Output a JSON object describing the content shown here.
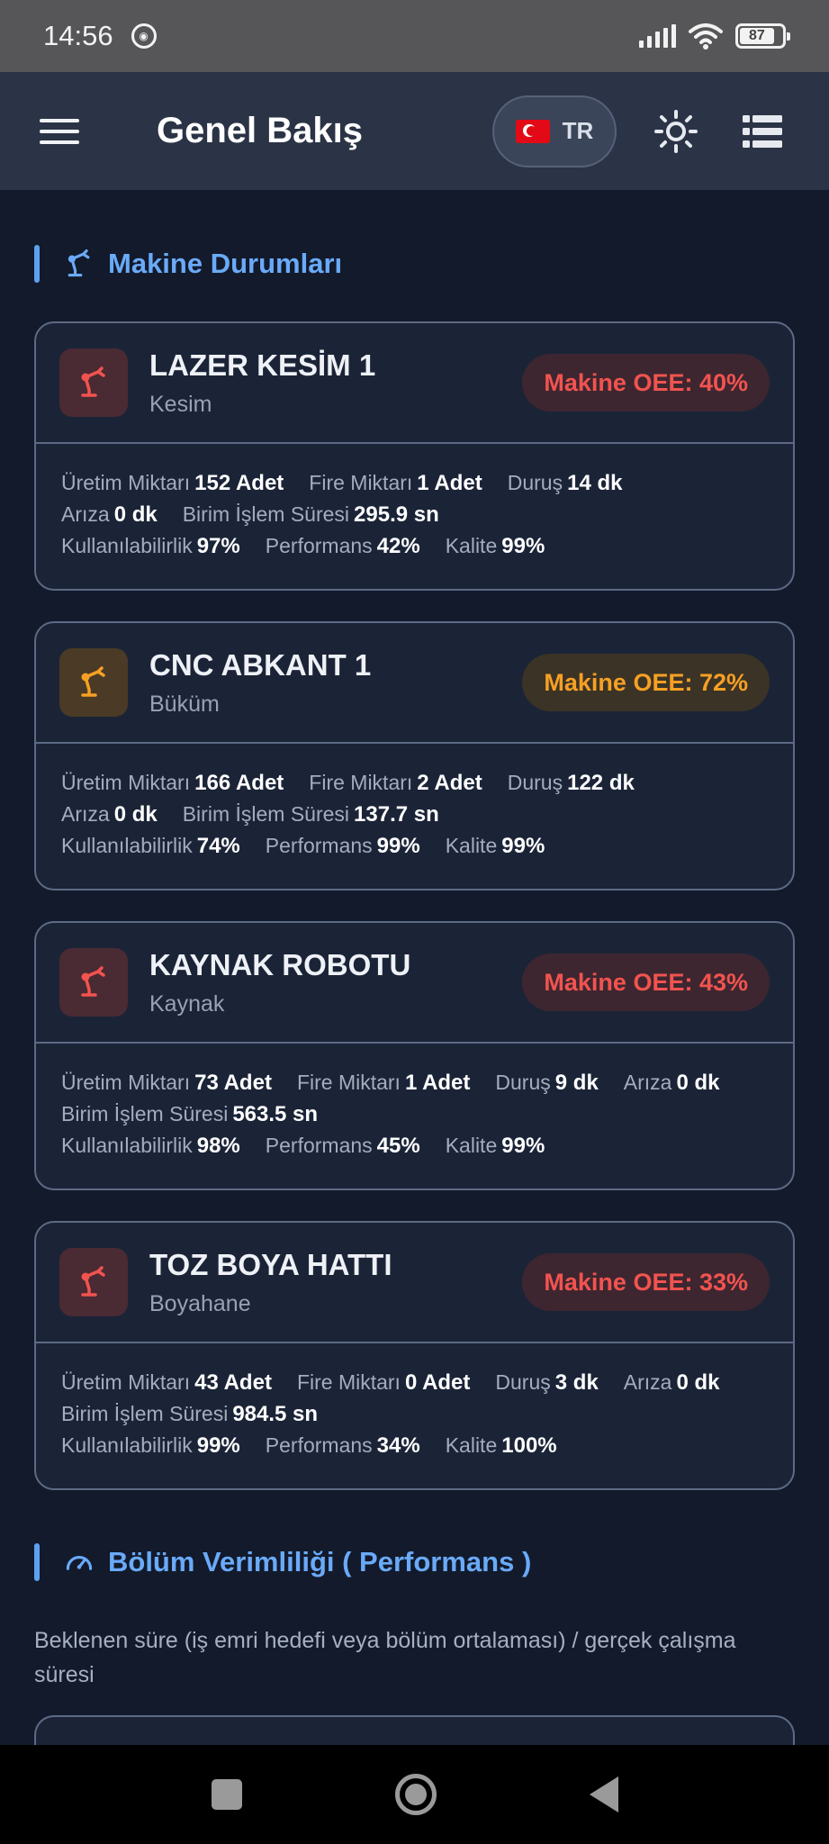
{
  "status": {
    "time": "14:56",
    "battery": "87"
  },
  "appbar": {
    "title": "Genel Bakış",
    "lang": "TR"
  },
  "section1": {
    "title": "Makine Durumları"
  },
  "machines": [
    {
      "name": "LAZER KESİM 1",
      "dept": "Kesim",
      "oee": "Makine OEE: 40%",
      "tone": "red",
      "rows": [
        [
          [
            "Üretim Miktarı",
            "152 Adet"
          ],
          [
            "Fire Miktarı",
            "1 Adet"
          ],
          [
            "Duruş",
            "14 dk"
          ]
        ],
        [
          [
            "Arıza",
            "0 dk"
          ],
          [
            "Birim İşlem Süresi",
            "295.9 sn"
          ]
        ],
        [
          [
            "Kullanılabilirlik",
            "97%"
          ],
          [
            "Performans",
            "42%"
          ],
          [
            "Kalite",
            "99%"
          ]
        ]
      ]
    },
    {
      "name": "CNC ABKANT 1",
      "dept": "Büküm",
      "oee": "Makine OEE: 72%",
      "tone": "amber",
      "rows": [
        [
          [
            "Üretim Miktarı",
            "166 Adet"
          ],
          [
            "Fire Miktarı",
            "2 Adet"
          ],
          [
            "Duruş",
            "122 dk"
          ]
        ],
        [
          [
            "Arıza",
            "0 dk"
          ],
          [
            "Birim İşlem Süresi",
            "137.7 sn"
          ]
        ],
        [
          [
            "Kullanılabilirlik",
            "74%"
          ],
          [
            "Performans",
            "99%"
          ],
          [
            "Kalite",
            "99%"
          ]
        ]
      ]
    },
    {
      "name": "KAYNAK ROBOTU",
      "dept": "Kaynak",
      "oee": "Makine OEE: 43%",
      "tone": "red",
      "rows": [
        [
          [
            "Üretim Miktarı",
            "73 Adet"
          ],
          [
            "Fire Miktarı",
            "1 Adet"
          ],
          [
            "Duruş",
            "9 dk"
          ],
          [
            "Arıza",
            "0 dk"
          ]
        ],
        [
          [
            "Birim İşlem Süresi",
            "563.5 sn"
          ]
        ],
        [
          [
            "Kullanılabilirlik",
            "98%"
          ],
          [
            "Performans",
            "45%"
          ],
          [
            "Kalite",
            "99%"
          ]
        ]
      ]
    },
    {
      "name": "TOZ BOYA HATTI",
      "dept": "Boyahane",
      "oee": "Makine OEE: 33%",
      "tone": "red",
      "rows": [
        [
          [
            "Üretim Miktarı",
            "43 Adet"
          ],
          [
            "Fire Miktarı",
            "0 Adet"
          ],
          [
            "Duruş",
            "3 dk"
          ],
          [
            "Arıza",
            "0 dk"
          ]
        ],
        [
          [
            "Birim İşlem Süresi",
            "984.5 sn"
          ]
        ],
        [
          [
            "Kullanılabilirlik",
            "99%"
          ],
          [
            "Performans",
            "34%"
          ],
          [
            "Kalite",
            "100%"
          ]
        ]
      ]
    }
  ],
  "section2": {
    "title": "Bölüm Verimliliği ( Performans )",
    "desc": "Beklenen süre (iş emri hedefi veya bölüm ortalaması) / gerçek çalışma süresi"
  }
}
